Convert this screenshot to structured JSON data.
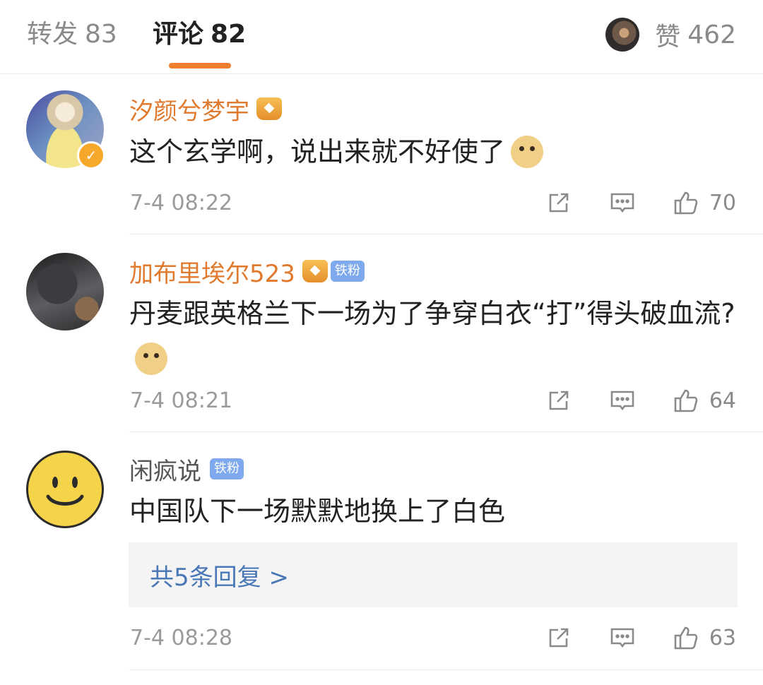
{
  "tabs": {
    "repost": {
      "label": "转发",
      "count": "83"
    },
    "comment": {
      "label": "评论",
      "count": "82"
    },
    "like": {
      "label": "赞",
      "count": "462"
    }
  },
  "comments": [
    {
      "username": "汐颜兮梦宇",
      "text": "这个玄学啊，说出来就不好使了",
      "time": "7-4 08:22",
      "likes": "70"
    },
    {
      "username": "加布里埃尔523",
      "badge": "铁粉",
      "text": "丹麦跟英格兰下一场为了争穿白衣“打”得头破血流?",
      "time": "7-4 08:21",
      "likes": "64"
    },
    {
      "username": "闲疯说",
      "badge": "铁粉",
      "text": "中国队下一场默默地换上了白色",
      "reply_link": "共5条回复 >",
      "time": "7-4 08:28",
      "likes": "63"
    }
  ],
  "icons": {
    "repost": "repost-icon",
    "reply": "comment-icon",
    "like": "thumbs-up-icon"
  },
  "colors": {
    "accent": "#ee7e2d",
    "username": "#e07a2e",
    "link": "#4a78b7",
    "muted": "#9a9a9a"
  }
}
